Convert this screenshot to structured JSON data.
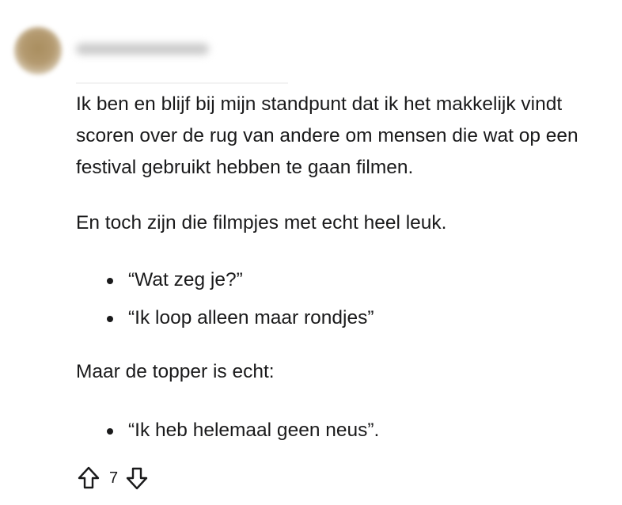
{
  "comment": {
    "paragraph_1": "Ik ben en blijf bij mijn standpunt dat ik het makkelijk vindt scoren over de rug van andere om mensen die wat op een festival gebruikt hebben te gaan filmen.",
    "paragraph_2": "En toch zijn die filmpjes met echt heel leuk.",
    "list_1": [
      "“Wat zeg je?”",
      "“Ik loop alleen maar rondjes”"
    ],
    "paragraph_3": "Maar de topper is echt:",
    "list_2": [
      "“Ik heb helemaal geen neus”."
    ]
  },
  "actions": {
    "upvote_icon": "arrow-up-outline-icon",
    "vote_count": "7",
    "downvote_icon": "arrow-down-outline-icon"
  },
  "colors": {
    "text": "#1a1a1b",
    "icon": "#1a1a1b",
    "background": "#ffffff"
  }
}
